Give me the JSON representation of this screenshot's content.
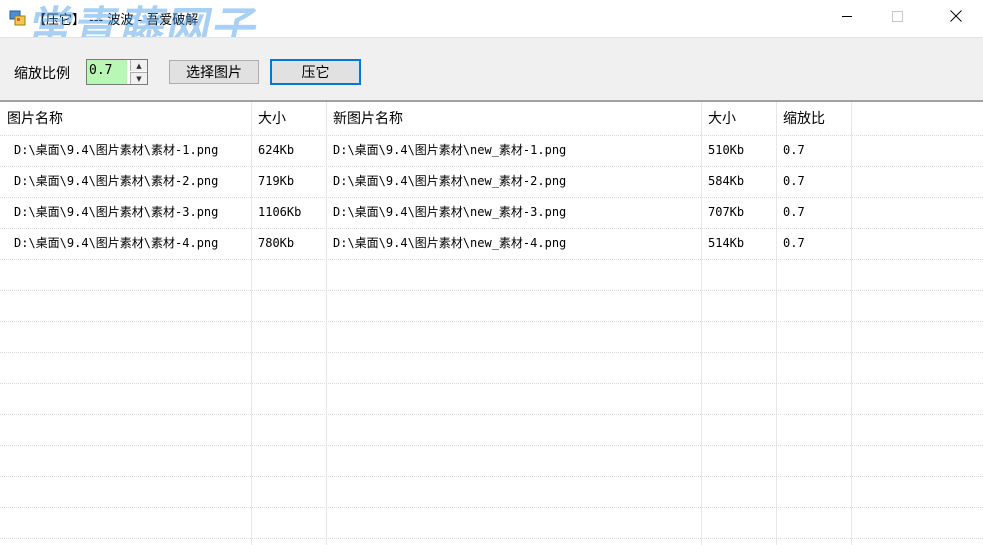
{
  "window": {
    "title": "【压它】 --- 波波 - 吾爱破解",
    "watermark": "常青藤网子"
  },
  "toolbar": {
    "scale_label": "缩放比例",
    "scale_value": "0.7",
    "select_button": "选择图片",
    "compress_button": "压它"
  },
  "table": {
    "headers": [
      "图片名称",
      "大小",
      "新图片名称",
      "大小",
      "缩放比"
    ],
    "rows": [
      [
        "D:\\桌面\\9.4\\图片素材\\素材-1.png",
        "624Kb",
        "D:\\桌面\\9.4\\图片素材\\new_素材-1.png",
        "510Kb",
        "0.7"
      ],
      [
        "D:\\桌面\\9.4\\图片素材\\素材-2.png",
        "719Kb",
        "D:\\桌面\\9.4\\图片素材\\new_素材-2.png",
        "584Kb",
        "0.7"
      ],
      [
        "D:\\桌面\\9.4\\图片素材\\素材-3.png",
        "1106Kb",
        "D:\\桌面\\9.4\\图片素材\\new_素材-3.png",
        "707Kb",
        "0.7"
      ],
      [
        "D:\\桌面\\9.4\\图片素材\\素材-4.png",
        "780Kb",
        "D:\\桌面\\9.4\\图片素材\\new_素材-4.png",
        "514Kb",
        "0.7"
      ]
    ]
  },
  "icons": {
    "app": "app-icon",
    "minimize": "minimize-icon",
    "maximize": "maximize-icon",
    "close": "close-icon",
    "spin_up": "triangle-up-icon",
    "spin_down": "triangle-down-icon"
  },
  "colors": {
    "scale_value_bg": "#b9f7b5",
    "primary_border": "#0078d7",
    "toolbar_bg": "#f0f0f0",
    "watermark": "#3c96e6"
  }
}
